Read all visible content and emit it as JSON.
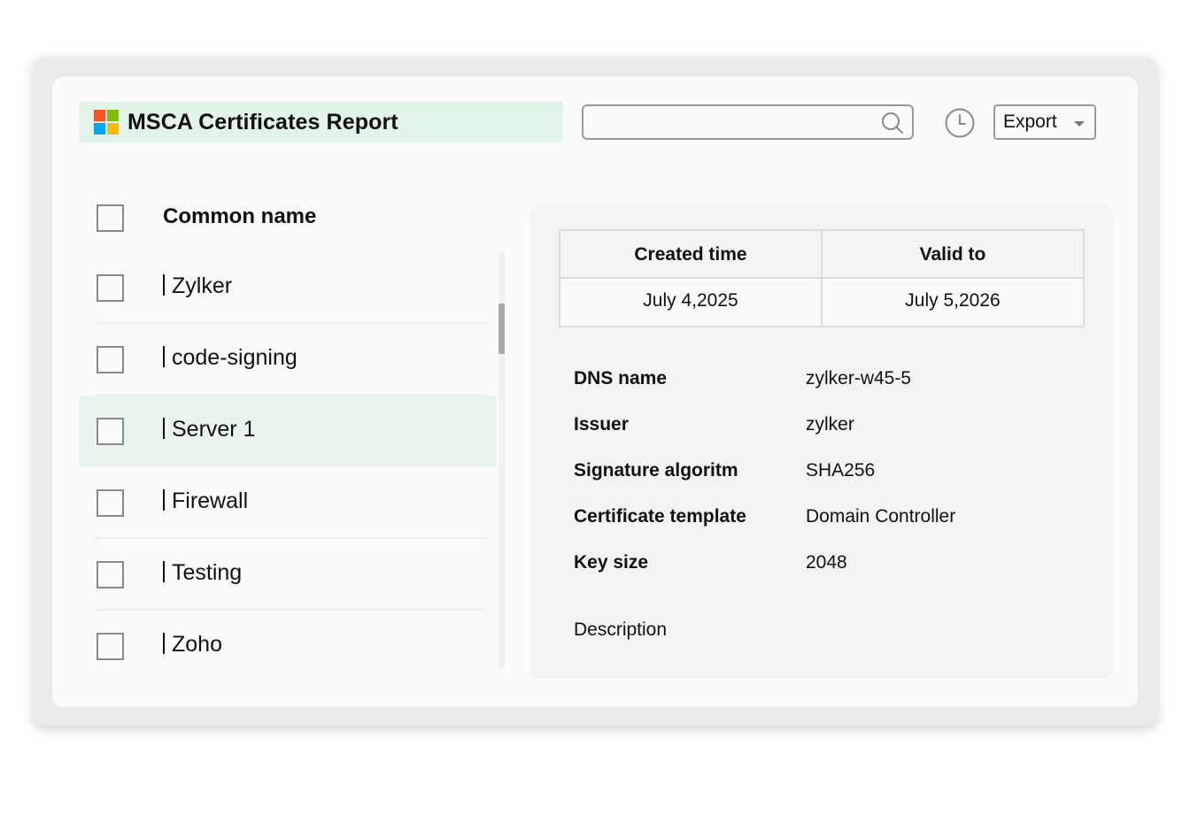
{
  "header": {
    "title": "MSCA Certificates Report",
    "logo_colors": [
      "#f35325",
      "#81bc06",
      "#05a6f0",
      "#ffba08"
    ],
    "search_value": "",
    "search_placeholder": "",
    "export_label": "Export"
  },
  "list": {
    "column_title": "Common name",
    "rows": [
      {
        "label": "Zylker",
        "selected": false
      },
      {
        "label": "code-signing",
        "selected": false
      },
      {
        "label": "Server 1",
        "selected": true
      },
      {
        "label": "Firewall",
        "selected": false
      },
      {
        "label": "Testing",
        "selected": false
      },
      {
        "label": "Zoho",
        "selected": false
      }
    ]
  },
  "details": {
    "dates": {
      "headers": [
        "Created time",
        "Valid to"
      ],
      "values": [
        "July 4,2025",
        "July 5,2026"
      ]
    },
    "properties": [
      {
        "key": "DNS name",
        "value": "zylker-w45-5"
      },
      {
        "key": "Issuer",
        "value": "zylker"
      },
      {
        "key": "Signature algoritm",
        "value": "SHA256"
      },
      {
        "key": "Certificate template",
        "value": "Domain Controller"
      },
      {
        "key": "Key size",
        "value": "2048"
      }
    ],
    "description_label": "Description"
  },
  "colors": {
    "title_bg": "#e2f3e8",
    "selected_row_bg": "#e8f4ec"
  }
}
